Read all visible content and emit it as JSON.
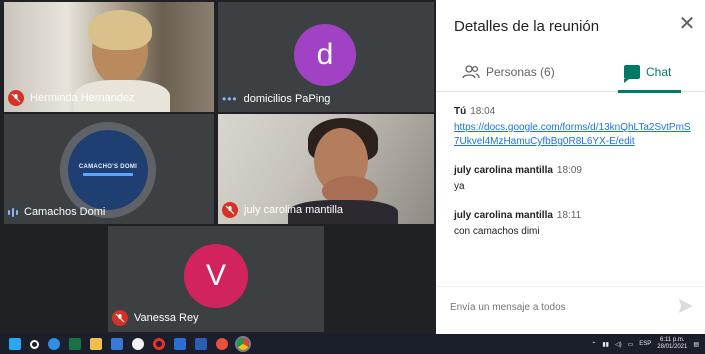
{
  "participants": [
    {
      "name": "Herminda Hernandez",
      "mic": "muted"
    },
    {
      "name": "domicilios PaPing",
      "mic": "active",
      "avatar_letter": "d",
      "avatar_color": "#a142c4"
    },
    {
      "name": "Camachos Domi",
      "mic": "speaking",
      "logo_text": "CAMACHO'S DOMI"
    },
    {
      "name": "july carolina mantilla",
      "mic": "muted"
    },
    {
      "name": "Vanessa Rey",
      "mic": "muted",
      "avatar_letter": "V",
      "avatar_color": "#d1245e"
    }
  ],
  "panel": {
    "title": "Detalles de la reunión",
    "close_icon": "close-icon",
    "tabs": {
      "people_label": "Personas (6)",
      "chat_label": "Chat"
    },
    "messages": [
      {
        "sender": "Tú",
        "time": "18:04",
        "text": "https://docs.google.com/forms/d/13knQhLTa2SvtPmS7Ukvel4MzHamuCyfbBg0R8L6YX-E/edit",
        "is_link": true
      },
      {
        "sender": "july carolina mantilla",
        "time": "18:09",
        "text": "ya",
        "is_link": false
      },
      {
        "sender": "july carolina mantilla",
        "time": "18:11",
        "text": "con camachos dimi",
        "is_link": false
      }
    ],
    "composer_placeholder": "Envía un mensaje a todos"
  },
  "taskbar": {
    "lang": "ESP",
    "time": "6:11 p.m.",
    "date": "28/01/2021"
  },
  "colors": {
    "accent": "#00796b",
    "link": "#1a73e8",
    "mute_red": "#d93025"
  }
}
